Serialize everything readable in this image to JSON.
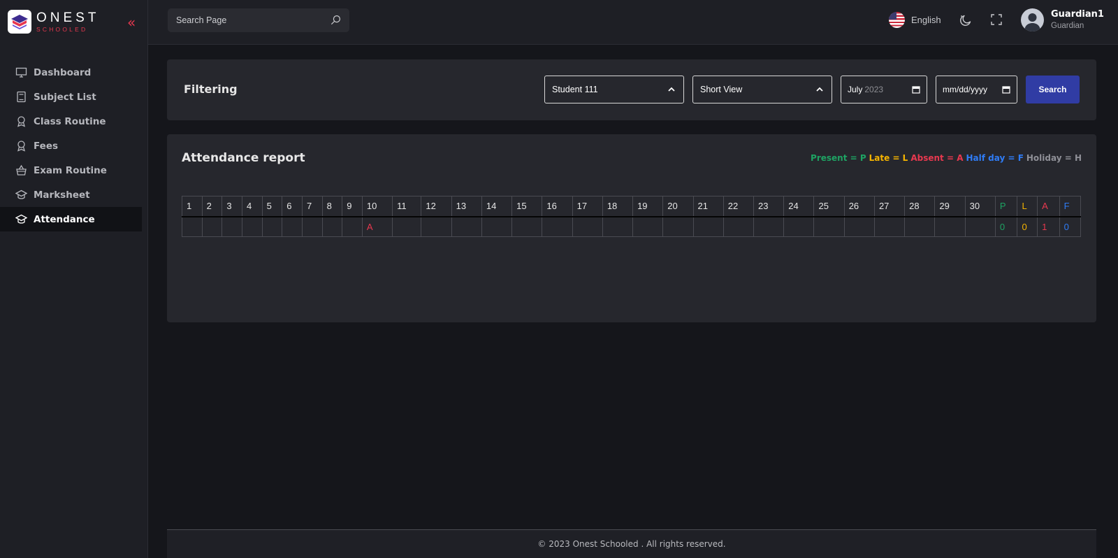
{
  "brand": {
    "name": "ONEST",
    "tagline": "SCHOOLED"
  },
  "sidebar": {
    "collapse_label": "«",
    "items": [
      {
        "label": "Dashboard",
        "icon": "monitor-icon",
        "active": false
      },
      {
        "label": "Subject List",
        "icon": "book-icon",
        "active": false
      },
      {
        "label": "Class Routine",
        "icon": "award-icon",
        "active": false
      },
      {
        "label": "Fees",
        "icon": "award-icon",
        "active": false
      },
      {
        "label": "Exam Routine",
        "icon": "basket-icon",
        "active": false
      },
      {
        "label": "Marksheet",
        "icon": "graduation-cap-icon",
        "active": false
      },
      {
        "label": "Attendance",
        "icon": "graduation-cap-icon",
        "active": true
      }
    ]
  },
  "header": {
    "search_placeholder": "Search Page",
    "language": "English",
    "user_name": "Guardian1",
    "user_role": "Guardian"
  },
  "filter": {
    "title": "Filtering",
    "student_select": "Student 111",
    "view_select": "Short View",
    "month_value": "July",
    "month_year": "2023",
    "date_placeholder": "mm/dd/yyyy",
    "search_label": "Search"
  },
  "attendance": {
    "title": "Attendance report",
    "legend": [
      {
        "text": "Present = P",
        "color": "#1ea363"
      },
      {
        "text": "Late = L",
        "color": "#f5b400"
      },
      {
        "text": "Absent = A",
        "color": "#e8384f"
      },
      {
        "text": "Half day = F",
        "color": "#2f7cf6"
      },
      {
        "text": "Holiday = H",
        "color": "#8f9097"
      }
    ],
    "days": [
      "1",
      "2",
      "3",
      "4",
      "5",
      "6",
      "7",
      "8",
      "9",
      "10",
      "11",
      "12",
      "13",
      "14",
      "15",
      "16",
      "17",
      "18",
      "19",
      "20",
      "21",
      "22",
      "23",
      "24",
      "25",
      "26",
      "27",
      "28",
      "29",
      "30"
    ],
    "summary_headers": [
      {
        "text": "P",
        "color": "#1ea363"
      },
      {
        "text": "L",
        "color": "#f5b400"
      },
      {
        "text": "A",
        "color": "#e8384f"
      },
      {
        "text": "F",
        "color": "#2f7cf6"
      }
    ],
    "row": [
      "",
      "",
      "",
      "",
      "",
      "",
      "",
      "",
      "",
      "A",
      "",
      "",
      "",
      "",
      "",
      "",
      "",
      "",
      "",
      "",
      "",
      "",
      "",
      "",
      "",
      "",
      "",
      "",
      "",
      ""
    ],
    "row_colors": {
      "A": "#e8384f"
    },
    "summary_values": [
      {
        "text": "0",
        "color": "#1ea363"
      },
      {
        "text": "0",
        "color": "#f5b400"
      },
      {
        "text": "1",
        "color": "#e8384f"
      },
      {
        "text": "0",
        "color": "#2f7cf6"
      }
    ]
  },
  "footer": {
    "text": "© 2023 Onest Schooled . All rights reserved."
  }
}
